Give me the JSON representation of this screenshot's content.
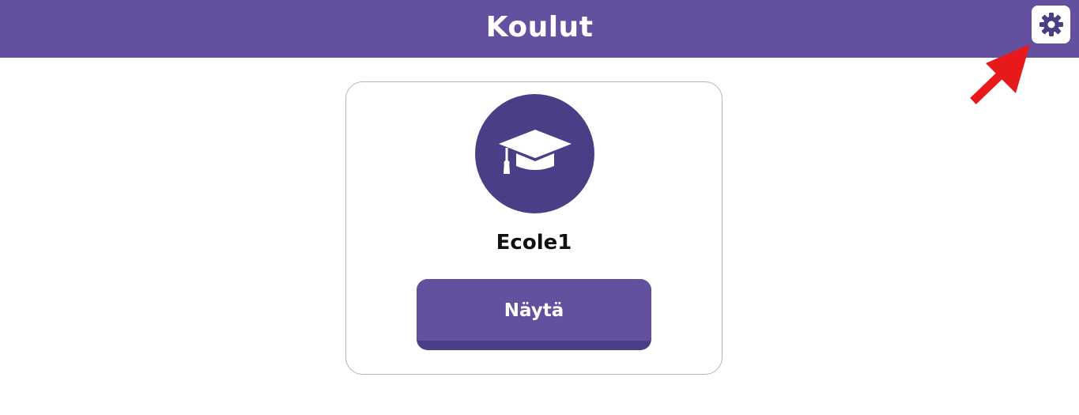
{
  "header": {
    "title": "Koulut",
    "settings_icon": "gear-icon",
    "background_color": "#6351a0"
  },
  "annotation": {
    "arrow_icon": "red-arrow-icon",
    "arrow_color": "#e8191b"
  },
  "schools": [
    {
      "icon": "graduation-cap-icon",
      "name": "Ecole1",
      "button_label": "Näytä"
    }
  ],
  "colors": {
    "accent": "#6351a0",
    "accent_dark": "#4c3e86",
    "card_border": "#b5b5b5"
  }
}
